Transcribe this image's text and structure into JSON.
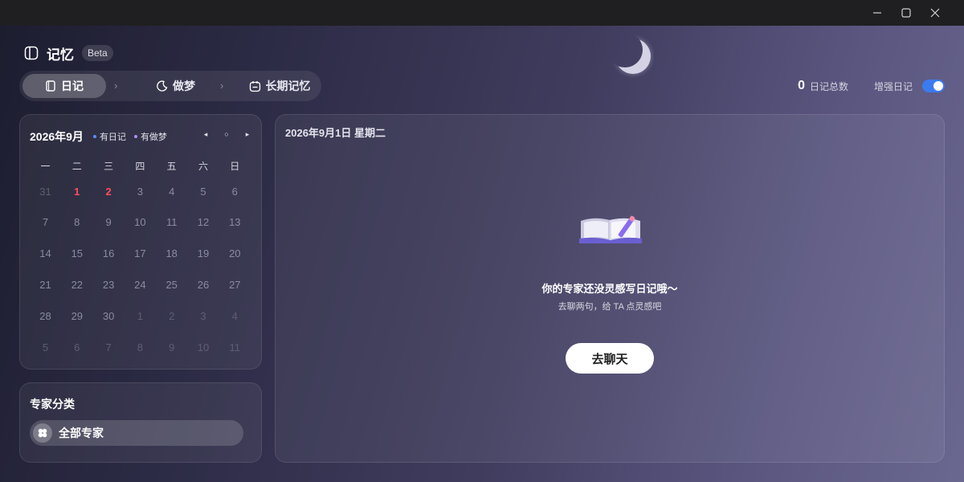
{
  "window": {
    "minimize": "—",
    "maximize": "□",
    "close": "✕"
  },
  "brand": {
    "title": "记忆",
    "badge": "Beta"
  },
  "nav": {
    "items": [
      {
        "label": "日记",
        "icon": "diary-icon",
        "active": true
      },
      {
        "label": "做梦",
        "icon": "moon-icon",
        "active": false
      },
      {
        "label": "长期记忆",
        "icon": "calendar-memory-icon",
        "active": false
      }
    ],
    "separator": "›"
  },
  "stats": {
    "count": "0",
    "count_label": "日记总数",
    "enhance_label": "增强日记",
    "enhance_on": true
  },
  "calendar": {
    "month_title": "2026年9月",
    "legend": [
      {
        "label": "有日记",
        "color": "#5b8cff"
      },
      {
        "label": "有做梦",
        "color": "#b48cff"
      }
    ],
    "nav": {
      "prev": "◂",
      "today": "○",
      "next": "▸"
    },
    "weekdays": [
      "一",
      "二",
      "三",
      "四",
      "五",
      "六",
      "日"
    ],
    "weeks": [
      [
        "31",
        "1",
        "2",
        "3",
        "4",
        "5",
        "6"
      ],
      [
        "7",
        "8",
        "9",
        "10",
        "11",
        "12",
        "13"
      ],
      [
        "14",
        "15",
        "16",
        "17",
        "18",
        "19",
        "20"
      ],
      [
        "21",
        "22",
        "23",
        "24",
        "25",
        "26",
        "27"
      ],
      [
        "28",
        "29",
        "30",
        "1",
        "2",
        "3",
        "4"
      ],
      [
        "5",
        "6",
        "7",
        "8",
        "9",
        "10",
        "11"
      ]
    ]
  },
  "categories": {
    "title": "专家分类",
    "items": [
      {
        "label": "全部专家",
        "icon": "clover-icon"
      }
    ]
  },
  "main": {
    "date": "2026年9月1日 星期二",
    "empty_title": "你的专家还没灵感写日记哦～",
    "empty_sub": "去聊两句，给 TA 点灵感吧",
    "chat_button": "去聊天"
  },
  "colors": {
    "accent": "#3b7bf0",
    "today_red": "#ff4d5a"
  }
}
